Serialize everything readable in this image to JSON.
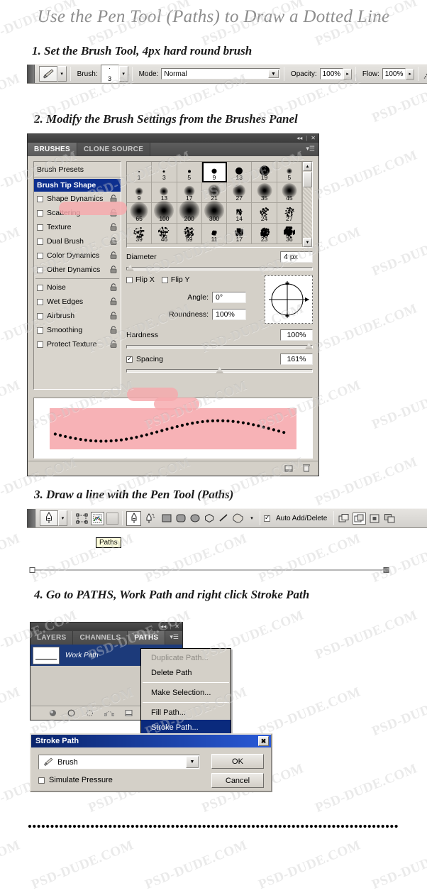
{
  "page": {
    "title": "Use the Pen Tool (Paths) to Draw a Dotted Line",
    "watermark_text": "PSD-DUDE.COM",
    "accent_pink": "#f7a8ac",
    "highlight_blue": "#0a2a7d"
  },
  "steps": [
    {
      "num": "1",
      "title": "1. Set the Brush Tool, 4px hard round brush"
    },
    {
      "num": "2",
      "title": "2. Modify the Brush Settings from the Brushes Panel"
    },
    {
      "num": "3",
      "title": "3. Draw a line with the Pen Tool (Paths)"
    },
    {
      "num": "4",
      "title": "4. Go to PATHS, Work Path and right click Stroke Path"
    }
  ],
  "brush_options_bar": {
    "brush_label": "Brush:",
    "brush_size_value": "3",
    "mode_label": "Mode:",
    "mode_value": "Normal",
    "opacity_label": "Opacity:",
    "opacity_value": "100%",
    "flow_label": "Flow:",
    "flow_value": "100%",
    "tool_icon": "brush-tool-icon",
    "airbrush_icon": "airbrush-icon"
  },
  "brushes_panel": {
    "tabs": [
      {
        "label": "BRUSHES",
        "active": true
      },
      {
        "label": "CLONE SOURCE",
        "active": false
      }
    ],
    "collapse_icon": "collapse-icon",
    "close_icon": "close-icon",
    "menu_icon": "panel-menu-icon",
    "list": [
      {
        "label": "Brush Presets",
        "type": "header",
        "checked": false,
        "locked": true
      },
      {
        "label": "Brush Tip Shape",
        "type": "selected",
        "checked": false,
        "locked": false
      },
      {
        "label": "Shape Dynamics",
        "type": "check",
        "checked": false,
        "locked": true
      },
      {
        "label": "Scattering",
        "type": "check",
        "checked": false,
        "locked": true
      },
      {
        "label": "Texture",
        "type": "check",
        "checked": false,
        "locked": true
      },
      {
        "label": "Dual Brush",
        "type": "check",
        "checked": false,
        "locked": true
      },
      {
        "label": "Color Dynamics",
        "type": "check",
        "checked": false,
        "locked": true
      },
      {
        "label": "Other Dynamics",
        "type": "check",
        "checked": false,
        "locked": true
      },
      {
        "label": "Noise",
        "type": "check",
        "checked": false,
        "locked": true
      },
      {
        "label": "Wet Edges",
        "type": "check",
        "checked": false,
        "locked": true
      },
      {
        "label": "Airbrush",
        "type": "check",
        "checked": false,
        "locked": true
      },
      {
        "label": "Smoothing",
        "type": "check",
        "checked": false,
        "locked": true
      },
      {
        "label": "Protect Texture",
        "type": "check",
        "checked": false,
        "locked": true
      }
    ],
    "brush_grid": [
      {
        "size": "1",
        "dot": 2,
        "soft": 0,
        "kind": "round",
        "selected": false
      },
      {
        "size": "3",
        "dot": 3,
        "soft": 0,
        "kind": "round",
        "selected": false
      },
      {
        "size": "5",
        "dot": 4,
        "soft": 0,
        "kind": "round",
        "selected": false
      },
      {
        "size": "9",
        "dot": 7,
        "soft": 0,
        "kind": "round",
        "selected": true
      },
      {
        "size": "13",
        "dot": 10,
        "soft": 0,
        "kind": "round",
        "selected": false
      },
      {
        "size": "19",
        "dot": 14,
        "soft": 0,
        "kind": "round",
        "selected": false
      },
      {
        "size": "5",
        "dot": 4,
        "soft": 2,
        "kind": "round",
        "selected": false
      },
      {
        "size": "9",
        "dot": 5,
        "soft": 3,
        "kind": "round",
        "selected": false
      },
      {
        "size": "13",
        "dot": 6,
        "soft": 3,
        "kind": "round",
        "selected": false
      },
      {
        "size": "17",
        "dot": 7,
        "soft": 4,
        "kind": "round",
        "selected": false
      },
      {
        "size": "21",
        "dot": 8,
        "soft": 5,
        "kind": "round",
        "selected": false
      },
      {
        "size": "27",
        "dot": 8,
        "soft": 5,
        "kind": "round",
        "selected": false
      },
      {
        "size": "35",
        "dot": 9,
        "soft": 6,
        "kind": "round",
        "selected": false
      },
      {
        "size": "45",
        "dot": 9,
        "soft": 6,
        "kind": "round",
        "selected": false
      },
      {
        "size": "65",
        "dot": 11,
        "soft": 7,
        "kind": "round",
        "selected": false
      },
      {
        "size": "100",
        "dot": 12,
        "soft": 8,
        "kind": "round",
        "selected": false
      },
      {
        "size": "200",
        "dot": 13,
        "soft": 8,
        "kind": "round",
        "selected": false
      },
      {
        "size": "300",
        "dot": 12,
        "soft": 8,
        "kind": "round",
        "selected": false
      },
      {
        "size": "14",
        "dot": 10,
        "soft": 0,
        "kind": "spatter",
        "selected": false
      },
      {
        "size": "24",
        "dot": 13,
        "soft": 0,
        "kind": "spatter",
        "selected": false
      },
      {
        "size": "27",
        "dot": 14,
        "soft": 0,
        "kind": "spatter",
        "selected": false
      },
      {
        "size": "39",
        "dot": 15,
        "soft": 0,
        "kind": "spatter",
        "selected": false
      },
      {
        "size": "46",
        "dot": 16,
        "soft": 0,
        "kind": "spatter",
        "selected": false
      },
      {
        "size": "59",
        "dot": 16,
        "soft": 0,
        "kind": "spatter",
        "selected": false
      },
      {
        "size": "11",
        "dot": 7,
        "soft": 0,
        "kind": "chalk",
        "selected": false
      },
      {
        "size": "17",
        "dot": 12,
        "soft": 0,
        "kind": "chalk",
        "selected": false
      },
      {
        "size": "23",
        "dot": 14,
        "soft": 0,
        "kind": "chalk",
        "selected": false
      },
      {
        "size": "36",
        "dot": 16,
        "soft": 0,
        "kind": "chalk",
        "selected": false
      }
    ],
    "controls": {
      "diameter_label": "Diameter",
      "diameter_value": "4 px",
      "flip_x_label": "Flip X",
      "flip_x_checked": false,
      "flip_y_label": "Flip Y",
      "flip_y_checked": false,
      "angle_label": "Angle:",
      "angle_value": "0°",
      "roundness_label": "Roundness:",
      "roundness_value": "100%",
      "hardness_label": "Hardness",
      "hardness_value": "100%",
      "spacing_label": "Spacing",
      "spacing_checked": true,
      "spacing_value": "161%"
    },
    "footer_icons": [
      "new-brush-icon",
      "delete-brush-icon"
    ]
  },
  "pen_options_bar": {
    "tool_icon": "pen-tool-icon",
    "shape_layer_icon": "shape-layers-icon",
    "paths_icon": "paths-icon",
    "fill_pixels_icon": "fill-pixels-icon",
    "shape_icons": [
      "pen-icon",
      "freeform-pen-icon",
      "rectangle-icon",
      "rounded-rect-icon",
      "ellipse-icon",
      "polygon-icon",
      "line-icon",
      "custom-shape-icon"
    ],
    "auto_add_delete_label": "Auto Add/Delete",
    "auto_add_delete_checked": true,
    "boolean_icons": [
      "add-to-shape-icon",
      "subtract-from-shape-icon",
      "intersect-shape-icon",
      "exclude-shape-icon"
    ],
    "tooltip": "Paths"
  },
  "paths_panel": {
    "tabs": [
      {
        "label": "LAYERS",
        "active": false
      },
      {
        "label": "CHANNELS",
        "active": false
      },
      {
        "label": "PATHS",
        "active": true
      }
    ],
    "collapse_icon": "collapse-icon",
    "close_icon": "close-icon",
    "menu_icon": "panel-menu-icon",
    "path_name": "Work Path",
    "footer_icons": [
      "fill-path-icon",
      "stroke-path-icon",
      "load-selection-icon",
      "make-workpath-icon",
      "new-path-icon"
    ]
  },
  "context_menu": {
    "items": [
      {
        "label": "Duplicate Path...",
        "state": "disabled",
        "sep_after": false
      },
      {
        "label": "Delete Path",
        "state": "normal",
        "sep_after": true
      },
      {
        "label": "Make Selection...",
        "state": "normal",
        "sep_after": true
      },
      {
        "label": "Fill Path...",
        "state": "normal",
        "sep_after": false
      },
      {
        "label": "Stroke Path...",
        "state": "highlighted",
        "sep_after": false
      }
    ]
  },
  "stroke_dialog": {
    "title": "Stroke Path",
    "close_label": "✖",
    "tool_value": "Brush",
    "tool_icon": "brush-tool-icon",
    "simulate_label": "Simulate Pressure",
    "simulate_checked": false,
    "ok_label": "OK",
    "cancel_label": "Cancel"
  },
  "result": {
    "dotted_line_caption": "",
    "dot_color": "#000000"
  }
}
